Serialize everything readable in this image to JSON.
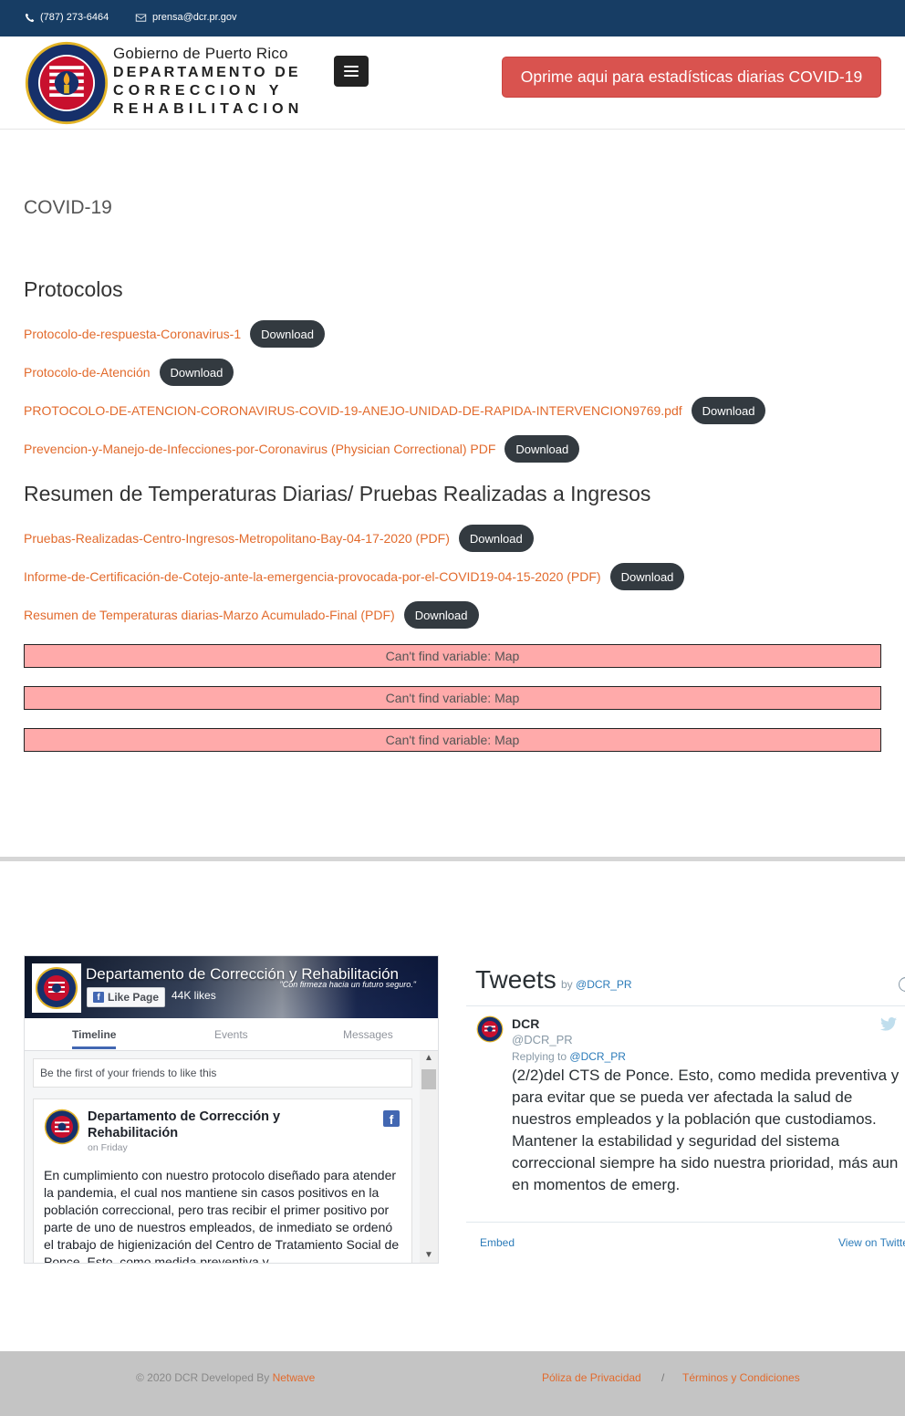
{
  "topbar": {
    "phone": "(787) 273-6464",
    "email": "prensa@dcr.pr.gov"
  },
  "header": {
    "brand_line1": "Gobierno de Puerto Rico",
    "brand_line2": "DEPARTAMENTO DE",
    "brand_line3": "CORRECCION Y",
    "brand_line4": "REHABILITACION",
    "seal_text_top": "DEPARTAMENTO DE CORRECCION Y REHABILITACION",
    "seal_text_bottom": "PUERTO RICO",
    "covid_button": "Oprime aqui para estadísticas diarias COVID-19"
  },
  "main": {
    "page_title": "COVID-19",
    "download_label": "Download",
    "protocolos": {
      "title": "Protocolos",
      "items": [
        {
          "label": "Protocolo-de-respuesta-Coronavirus-1"
        },
        {
          "label": "Protocolo-de-Atención"
        },
        {
          "label": "PROTOCOLO-DE-ATENCION-CORONAVIRUS-COVID-19-ANEJO-UNIDAD-DE-RAPIDA-INTERVENCION9769.pdf"
        },
        {
          "label": "Prevencion-y-Manejo-de-Infecciones-por-Coronavirus (Physician Correctional) PDF"
        }
      ]
    },
    "resumen": {
      "title": "Resumen de Temperaturas Diarias/ Pruebas Realizadas a Ingresos",
      "items": [
        {
          "label": "Pruebas-Realizadas-Centro-Ingresos-Metropolitano-Bay-04-17-2020 (PDF)"
        },
        {
          "label": "Informe-de-Certificación-de-Cotejo-ante-la-emergencia-provocada-por-el-COVID19-04-15-2020 (PDF)"
        },
        {
          "label": "Resumen de Temperaturas diarias-Marzo Acumulado-Final (PDF)"
        }
      ]
    },
    "errors": [
      "Can't find variable: Map",
      "Can't find variable: Map",
      "Can't find variable: Map"
    ]
  },
  "facebook": {
    "page_name": "Departamento de Corrección y Rehabilitación",
    "tagline": "\"Con firmeza hacia un futuro seguro.\"",
    "like_button": "Like Page",
    "likes": "44K likes",
    "tabs": [
      "Timeline",
      "Events",
      "Messages"
    ],
    "friends_note": "Be the first of your friends to like this",
    "post": {
      "author": "Departamento de Corrección y Rehabilitación",
      "date": "on Friday",
      "text": "En cumplimiento con nuestro protocolo diseñado para atender la pandemia, el cual nos mantiene sin casos positivos en la población correccional, pero tras recibir el primer positivo por parte de uno de nuestros empleados, de inmediato se ordenó el trabajo de higienización del Centro de Tratamiento Social de Ponce. Esto, como medida preventiva y"
    }
  },
  "twitter": {
    "title": "Tweets",
    "by_prefix": "by",
    "by_handle": "@DCR_PR",
    "tweet": {
      "name": "DCR",
      "handle": "@DCR_PR",
      "reply_prefix": "Replying to",
      "reply_handle": "@DCR_PR",
      "text": "(2/2)del CTS de Ponce. Esto, como medida preventiva y para evitar que se pueda ver afectada la salud de nuestros empleados y la población que custodiamos. Mantener la estabilidad y seguridad del sistema correccional siempre ha sido nuestra prioridad, más aun en momentos de emerg."
    },
    "embed": "Embed",
    "view_on": "View on Twitter"
  },
  "footer": {
    "copyright": "© 2020 DCR Developed By",
    "developer": "Netwave",
    "privacy": "Póliza de Privacidad",
    "separator": "/",
    "terms": "Términos y Condiciones"
  },
  "colors": {
    "topbar": "#173d64",
    "accent_link": "#e26a2c",
    "covid_button": "#d9534f",
    "download_button": "#333a40",
    "error_box": "#ffaaaa"
  }
}
